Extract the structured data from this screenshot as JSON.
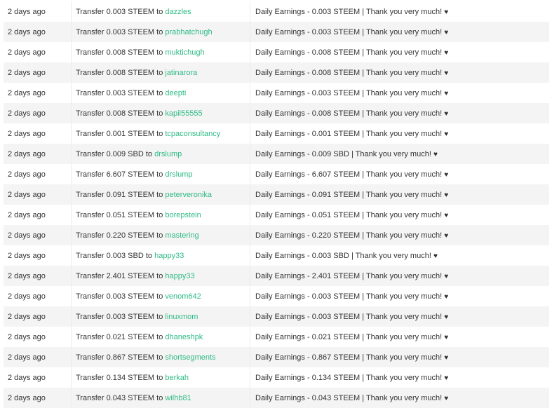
{
  "transfers": [
    {
      "time": "2 days ago",
      "prefix": "Transfer 0.003 STEEM to",
      "user": "dazzles",
      "memo": "Daily Earnings - 0.003 STEEM | Thank you very much!"
    },
    {
      "time": "2 days ago",
      "prefix": "Transfer 0.003 STEEM to",
      "user": "prabhatchugh",
      "memo": "Daily Earnings - 0.003 STEEM | Thank you very much!"
    },
    {
      "time": "2 days ago",
      "prefix": "Transfer 0.008 STEEM to",
      "user": "muktichugh",
      "memo": "Daily Earnings - 0.008 STEEM | Thank you very much!"
    },
    {
      "time": "2 days ago",
      "prefix": "Transfer 0.008 STEEM to",
      "user": "jatinarora",
      "memo": "Daily Earnings - 0.008 STEEM | Thank you very much!"
    },
    {
      "time": "2 days ago",
      "prefix": "Transfer 0.003 STEEM to",
      "user": "deepti",
      "memo": "Daily Earnings - 0.003 STEEM | Thank you very much!"
    },
    {
      "time": "2 days ago",
      "prefix": "Transfer 0.008 STEEM to",
      "user": "kapil55555",
      "memo": "Daily Earnings - 0.008 STEEM | Thank you very much!"
    },
    {
      "time": "2 days ago",
      "prefix": "Transfer 0.001 STEEM to",
      "user": "tcpaconsultancy",
      "memo": "Daily Earnings - 0.001 STEEM | Thank you very much!"
    },
    {
      "time": "2 days ago",
      "prefix": "Transfer 0.009 SBD to",
      "user": "drslump",
      "memo": "Daily Earnings - 0.009 SBD | Thank you very much!"
    },
    {
      "time": "2 days ago",
      "prefix": "Transfer 6.607 STEEM to",
      "user": "drslump",
      "memo": "Daily Earnings - 6.607 STEEM | Thank you very much!"
    },
    {
      "time": "2 days ago",
      "prefix": "Transfer 0.091 STEEM to",
      "user": "peterveronika",
      "memo": "Daily Earnings - 0.091 STEEM | Thank you very much!"
    },
    {
      "time": "2 days ago",
      "prefix": "Transfer 0.051 STEEM to",
      "user": "borepstein",
      "memo": "Daily Earnings - 0.051 STEEM | Thank you very much!"
    },
    {
      "time": "2 days ago",
      "prefix": "Transfer 0.220 STEEM to",
      "user": "mastering",
      "memo": "Daily Earnings - 0.220 STEEM | Thank you very much!"
    },
    {
      "time": "2 days ago",
      "prefix": "Transfer 0.003 SBD to",
      "user": "happy33",
      "memo": "Daily Earnings - 0.003 SBD | Thank you very much!"
    },
    {
      "time": "2 days ago",
      "prefix": "Transfer 2.401 STEEM to",
      "user": "happy33",
      "memo": "Daily Earnings - 2.401 STEEM | Thank you very much!"
    },
    {
      "time": "2 days ago",
      "prefix": "Transfer 0.003 STEEM to",
      "user": "venom642",
      "memo": "Daily Earnings - 0.003 STEEM | Thank you very much!"
    },
    {
      "time": "2 days ago",
      "prefix": "Transfer 0.003 STEEM to",
      "user": "linuxmom",
      "memo": "Daily Earnings - 0.003 STEEM | Thank you very much!"
    },
    {
      "time": "2 days ago",
      "prefix": "Transfer 0.021 STEEM to",
      "user": "dhaneshpk",
      "memo": "Daily Earnings - 0.021 STEEM | Thank you very much!"
    },
    {
      "time": "2 days ago",
      "prefix": "Transfer 0.867 STEEM to",
      "user": "shortsegments",
      "memo": "Daily Earnings - 0.867 STEEM | Thank you very much!"
    },
    {
      "time": "2 days ago",
      "prefix": "Transfer 0.134 STEEM to",
      "user": "berkah",
      "memo": "Daily Earnings - 0.134 STEEM | Thank you very much!"
    },
    {
      "time": "2 days ago",
      "prefix": "Transfer 0.043 STEEM to",
      "user": "wilhb81",
      "memo": "Daily Earnings - 0.043 STEEM | Thank you very much!"
    }
  ],
  "memo_icon": "heart-icon",
  "heart_glyph": "♥",
  "colors": {
    "link": "#2fbb86",
    "row_alt": "#f4f4f4",
    "text": "#333333"
  }
}
